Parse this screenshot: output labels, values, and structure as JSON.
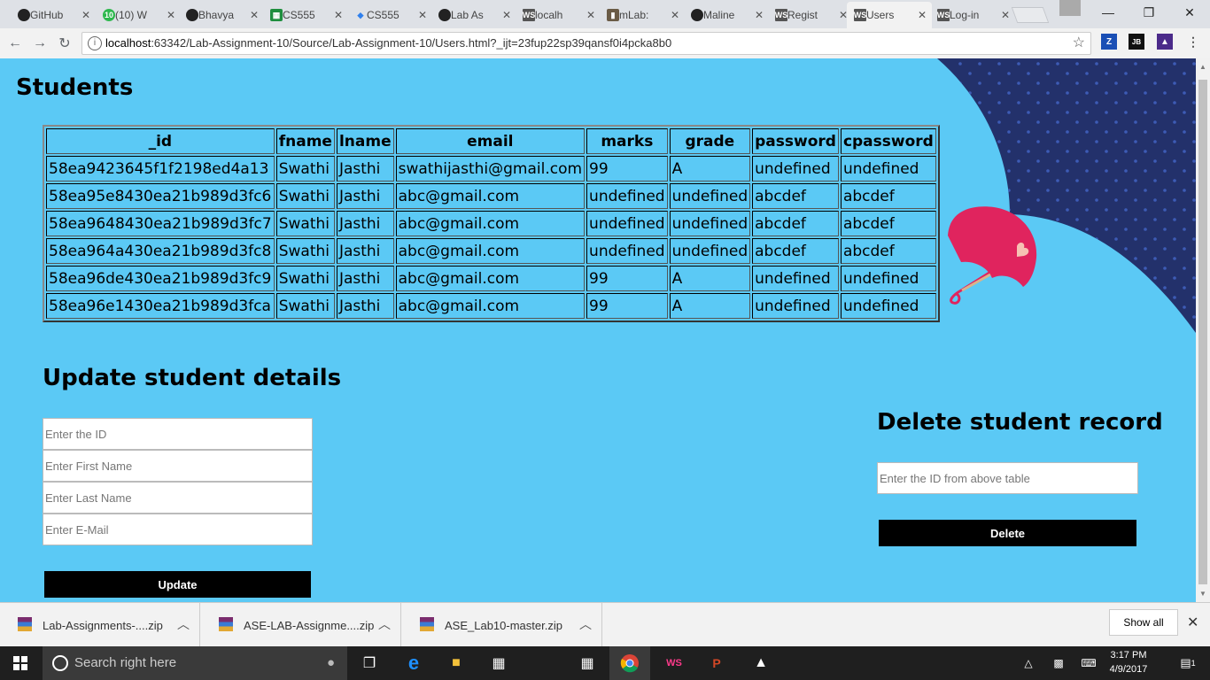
{
  "browser": {
    "tabs": [
      {
        "title": "GitHub",
        "favicon": "github-icon"
      },
      {
        "title": "(10) W",
        "favicon": "ten-badge-icon"
      },
      {
        "title": "Bhavya",
        "favicon": "github-icon"
      },
      {
        "title": "CS555",
        "favicon": "sheets-icon"
      },
      {
        "title": "CS555",
        "favicon": "dropbox-icon"
      },
      {
        "title": "Lab As",
        "favicon": "github-icon"
      },
      {
        "title": "localh",
        "favicon": "webstorm-icon"
      },
      {
        "title": "mLab:",
        "favicon": "mlab-icon"
      },
      {
        "title": "Maline",
        "favicon": "github-icon"
      },
      {
        "title": "Regist",
        "favicon": "webstorm-icon"
      },
      {
        "title": "Users",
        "favicon": "webstorm-icon",
        "active": true
      },
      {
        "title": "Log-in",
        "favicon": "webstorm-icon"
      }
    ],
    "url_host": "localhost",
    "url_rest": ":63342/Lab-Assignment-10/Source/Lab-Assignment-10/Users.html?_ijt=23fup22sp39qansf0i4pcka8b0"
  },
  "page": {
    "students_heading": "Students",
    "table": {
      "columns": [
        "_id",
        "fname",
        "lname",
        "email",
        "marks",
        "grade",
        "password",
        "cpassword"
      ],
      "rows": [
        [
          "58ea9423645f1f2198ed4a13",
          "Swathi",
          "Jasthi",
          "swathijasthi@gmail.com",
          "99",
          "A",
          "undefined",
          "undefined"
        ],
        [
          "58ea95e8430ea21b989d3fc6",
          "Swathi",
          "Jasthi",
          "abc@gmail.com",
          "undefined",
          "undefined",
          "abcdef",
          "abcdef"
        ],
        [
          "58ea9648430ea21b989d3fc7",
          "Swathi",
          "Jasthi",
          "abc@gmail.com",
          "undefined",
          "undefined",
          "abcdef",
          "abcdef"
        ],
        [
          "58ea964a430ea21b989d3fc8",
          "Swathi",
          "Jasthi",
          "abc@gmail.com",
          "undefined",
          "undefined",
          "abcdef",
          "abcdef"
        ],
        [
          "58ea96de430ea21b989d3fc9",
          "Swathi",
          "Jasthi",
          "abc@gmail.com",
          "99",
          "A",
          "undefined",
          "undefined"
        ],
        [
          "58ea96e1430ea21b989d3fca",
          "Swathi",
          "Jasthi",
          "abc@gmail.com",
          "99",
          "A",
          "undefined",
          "undefined"
        ]
      ]
    },
    "update": {
      "heading": "Update student details",
      "id_placeholder": "Enter the ID",
      "fname_placeholder": "Enter First Name",
      "lname_placeholder": "Enter Last Name",
      "email_placeholder": "Enter E-Mail",
      "button": "Update"
    },
    "delete": {
      "heading": "Delete student record",
      "id_placeholder": "Enter the ID from above table",
      "button": "Delete"
    }
  },
  "downloads": {
    "items": [
      {
        "name": "Lab-Assignments-....zip"
      },
      {
        "name": "ASE-LAB-Assignme....zip"
      },
      {
        "name": "ASE_Lab10-master.zip"
      }
    ],
    "show_all": "Show all"
  },
  "taskbar": {
    "search_placeholder": "Search right here",
    "time": "3:17 PM",
    "date": "4/9/2017",
    "notification_count": "1"
  },
  "colors": {
    "page_bg": "#5bc9f5",
    "deco_dark": "#23316b",
    "umbrella": "#e0245e"
  }
}
